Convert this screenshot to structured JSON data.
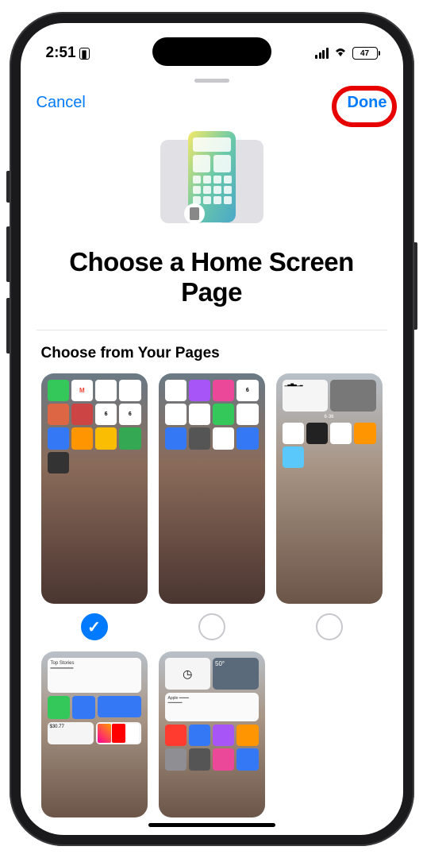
{
  "status": {
    "time": "2:51",
    "battery_pct": "47"
  },
  "nav": {
    "cancel": "Cancel",
    "done": "Done"
  },
  "header": {
    "title": "Choose a Home Screen Page"
  },
  "section": {
    "label": "Choose from Your Pages"
  },
  "pages": [
    {
      "selected": true
    },
    {
      "selected": false
    },
    {
      "selected": false
    },
    {
      "selected": false
    },
    {
      "selected": false
    }
  ],
  "annotation": {
    "highlight_target": "done-button",
    "color": "#e60000"
  },
  "colors": {
    "accent": "#007aff"
  }
}
